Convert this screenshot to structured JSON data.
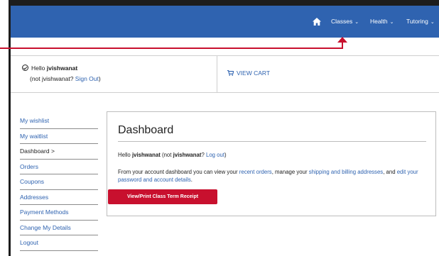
{
  "nav": {
    "items": [
      {
        "label": "Classes"
      },
      {
        "label": "Health"
      },
      {
        "label": "Tutoring"
      }
    ]
  },
  "account_bar": {
    "hello_prefix": "Hello ",
    "username": "jvishwanat",
    "not_user_prefix": "(not jvishwanat? ",
    "sign_out": "Sign Out",
    "not_user_suffix": ")",
    "view_cart": "VIEW CART"
  },
  "sidebar": {
    "items": [
      {
        "label": "My wishlist"
      },
      {
        "label": "My waitlist"
      },
      {
        "label": "Dashboard >"
      },
      {
        "label": "Orders"
      },
      {
        "label": "Coupons"
      },
      {
        "label": "Addresses"
      },
      {
        "label": "Payment Methods"
      },
      {
        "label": "Change My Details"
      },
      {
        "label": "Logout"
      }
    ]
  },
  "dashboard": {
    "title": "Dashboard",
    "hello_prefix": "Hello ",
    "username": "jvishwanat",
    "not_prefix": " (not ",
    "not_username": "jvishwanat",
    "not_mid": "? ",
    "log_out": "Log out",
    "not_suffix": ")",
    "p_text1": "From your account dashboard you can view your ",
    "recent_orders": "recent orders",
    "p_text2": ", manage your ",
    "addresses_link": "shipping and billing addresses",
    "p_text3": ", and ",
    "edit_link": "edit your password and account details",
    "p_text4": ".",
    "receipt_button": "View/Print Class Term Receipt"
  },
  "colors": {
    "nav_blue": "#2f63b0",
    "accent_red": "#c8102e"
  }
}
